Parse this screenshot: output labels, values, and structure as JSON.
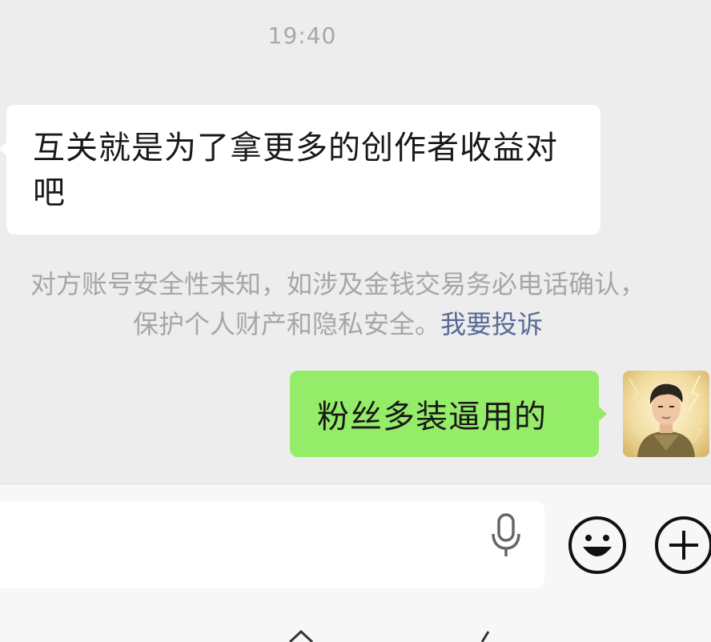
{
  "chat": {
    "timestamp": "19:40",
    "incoming_message": "互关就是为了拿更多的创作者收益对吧",
    "notice": {
      "line1": "对方账号安全性未知，如涉及金钱交易务必电话确认，",
      "line2_prefix": "保护个人财产和隐私安全。",
      "report_link": "我要投诉"
    },
    "outgoing_message": "粉丝多装逼用的",
    "avatar": {
      "icon": "user-avatar-photo"
    }
  },
  "input_bar": {
    "value": "",
    "mic_icon": "microphone-icon",
    "emoji_icon": "smiley-face-icon",
    "more_icon": "plus-circle-icon"
  },
  "colors": {
    "background": "#ededed",
    "incoming_bubble": "#ffffff",
    "outgoing_bubble": "#95ec69",
    "link": "#576b95",
    "muted_text": "#a6a6a6"
  }
}
